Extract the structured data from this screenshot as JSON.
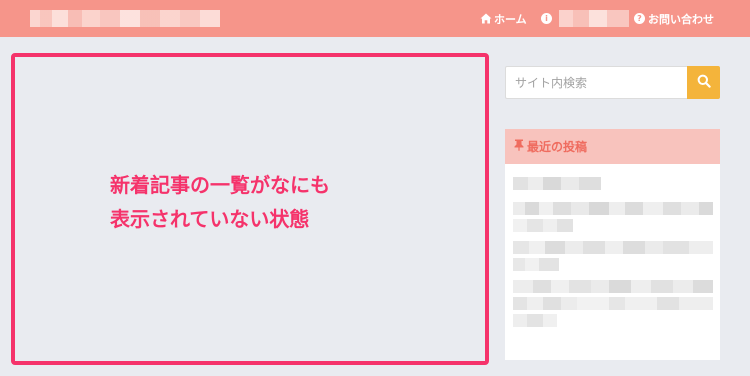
{
  "header": {
    "nav": {
      "home_label": "ホーム",
      "contact_label": "お問い合わせ",
      "home_icon": "home-icon",
      "info_icon": "info-circle-icon",
      "contact_icon": "question-circle-icon"
    }
  },
  "main": {
    "annotation_line1": "新着記事の一覧がなにも",
    "annotation_line2": "表示されていない状態"
  },
  "sidebar": {
    "search": {
      "placeholder": "サイト内検索",
      "icon": "search-icon"
    },
    "recent_posts": {
      "title": "最近の投稿",
      "icon": "pin-icon"
    }
  },
  "colors": {
    "header_bg": "#f6958a",
    "accent_pink": "#f5336b",
    "search_button": "#f4b43b",
    "widget_header_bg": "#f8c3bd",
    "widget_header_text": "#ef6c5f"
  }
}
